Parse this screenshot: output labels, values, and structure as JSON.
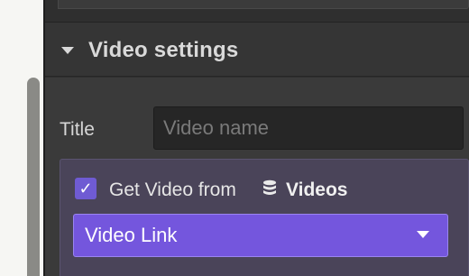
{
  "section": {
    "title": "Video settings",
    "expanded": true
  },
  "title_field": {
    "label": "Title",
    "placeholder": "Video name",
    "value": ""
  },
  "binding": {
    "checked": true,
    "label": "Get Video from",
    "collection_icon": "database-icon",
    "collection_name": "Videos",
    "field_select": {
      "selected": "Video Link"
    }
  },
  "colors": {
    "accent": "#7456dd",
    "binding_bg": "#4a4459",
    "panel_bg": "#3a3a3a"
  }
}
